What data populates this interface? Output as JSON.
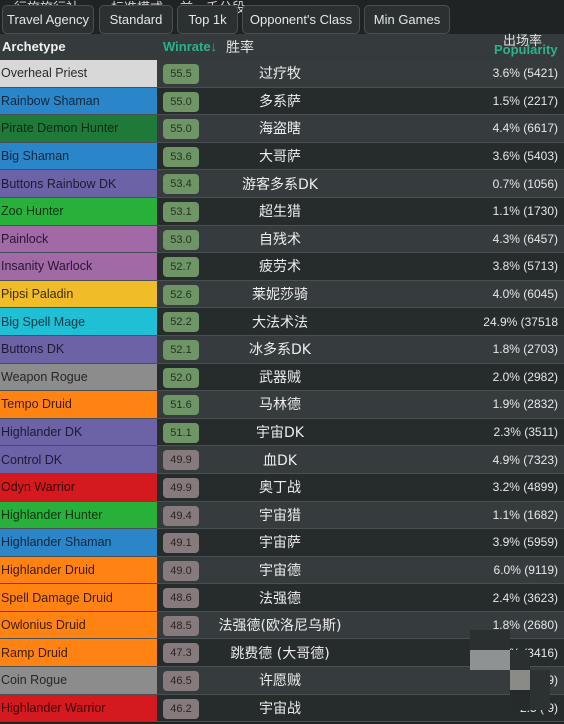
{
  "filters": [
    {
      "label": "Travel Agency",
      "zh": "行旅旅行社"
    },
    {
      "label": "Standard",
      "zh": "标准模式"
    },
    {
      "label": "Top 1k",
      "zh": "前一千分段"
    },
    {
      "label": "Opponent's Class",
      "zh": ""
    },
    {
      "label": "Min Games",
      "zh": ""
    }
  ],
  "header": {
    "archetype": "Archetype",
    "winrate": "Winrate↓",
    "winrate_zh": "胜率",
    "popularity": "Popularity",
    "popularity_zh": "出场率",
    "accent_color": "#2bb38e"
  },
  "badge_colors": {
    "positive": "#6f9466",
    "negative": "#877a7c"
  },
  "rows": [
    {
      "archetype": "Overheal Priest",
      "color": "#d8d8d8",
      "text_color": "#2a2a2a",
      "winrate": "55.5",
      "zh": "过疗牧",
      "popularity": "3.6% (5421)"
    },
    {
      "archetype": "Rainbow Shaman",
      "color": "#2b86c9",
      "text_color": "#10283d",
      "winrate": "55.0",
      "zh": "多系萨",
      "popularity": "1.5% (2217)"
    },
    {
      "archetype": "Pirate Demon Hunter",
      "color": "#1f7a3a",
      "text_color": "#0d2914",
      "winrate": "55.0",
      "zh": "海盗瞎",
      "popularity": "4.4% (6617)"
    },
    {
      "archetype": "Big Shaman",
      "color": "#2b86c9",
      "text_color": "#10283d",
      "winrate": "53.6",
      "zh": "大哥萨",
      "popularity": "3.6% (5403)"
    },
    {
      "archetype": "Buttons Rainbow DK",
      "color": "#6c63a6",
      "text_color": "#1c1a33",
      "winrate": "53.4",
      "zh": "游客多系DK",
      "popularity": "0.7% (1056)"
    },
    {
      "archetype": "Zoo Hunter",
      "color": "#28b13a",
      "text_color": "#0c3312",
      "winrate": "53.1",
      "zh": "超生猎",
      "popularity": "1.1% (1730)"
    },
    {
      "archetype": "Painlock",
      "color": "#a169a6",
      "text_color": "#2a1630",
      "winrate": "53.0",
      "zh": "自残术",
      "popularity": "4.3% (6457)"
    },
    {
      "archetype": "Insanity Warlock",
      "color": "#a169a6",
      "text_color": "#2a1630",
      "winrate": "52.7",
      "zh": "疲劳术",
      "popularity": "3.8% (5713)"
    },
    {
      "archetype": "Pipsi Paladin",
      "color": "#f0bd29",
      "text_color": "#3a2c05",
      "winrate": "52.6",
      "zh": "莱妮莎骑",
      "popularity": "4.0% (6045)"
    },
    {
      "archetype": "Big Spell Mage",
      "color": "#1fbfd6",
      "text_color": "#073a42",
      "winrate": "52.2",
      "zh": "大法术法",
      "popularity": "24.9% (37518"
    },
    {
      "archetype": "Buttons DK",
      "color": "#6c63a6",
      "text_color": "#1c1a33",
      "winrate": "52.1",
      "zh": "冰多系DK",
      "popularity": "1.8% (2703)"
    },
    {
      "archetype": "Weapon Rogue",
      "color": "#8c8c8c",
      "text_color": "#262626",
      "winrate": "52.0",
      "zh": "武器贼",
      "popularity": "2.0% (2982)"
    },
    {
      "archetype": "Tempo Druid",
      "color": "#ff8312",
      "text_color": "#3d1c02",
      "winrate": "51.6",
      "zh": "马林德",
      "popularity": "1.9% (2832)"
    },
    {
      "archetype": "Highlander DK",
      "color": "#6c63a6",
      "text_color": "#1c1a33",
      "winrate": "51.1",
      "zh": "宇宙DK",
      "popularity": "2.3% (3511)"
    },
    {
      "archetype": "Control DK",
      "color": "#6c63a6",
      "text_color": "#1c1a33",
      "winrate": "49.9",
      "zh": "血DK",
      "popularity": "4.9% (7323)"
    },
    {
      "archetype": "Odyn Warrior",
      "color": "#d41a1f",
      "text_color": "#3d0507",
      "winrate": "49.9",
      "zh": "奥丁战",
      "popularity": "3.2% (4899)"
    },
    {
      "archetype": "Highlander Hunter",
      "color": "#28b13a",
      "text_color": "#0c3312",
      "winrate": "49.4",
      "zh": "宇宙猎",
      "popularity": "1.1% (1682)"
    },
    {
      "archetype": "Highlander Shaman",
      "color": "#2b86c9",
      "text_color": "#10283d",
      "winrate": "49.1",
      "zh": "宇宙萨",
      "popularity": "3.9% (5959)"
    },
    {
      "archetype": "Highlander Druid",
      "color": "#ff8312",
      "text_color": "#3d1c02",
      "winrate": "49.0",
      "zh": "宇宙德",
      "popularity": "6.0% (9119)"
    },
    {
      "archetype": "Spell Damage Druid",
      "color": "#ff8312",
      "text_color": "#3d1c02",
      "winrate": "48.6",
      "zh": "法强德",
      "popularity": "2.4% (3623)"
    },
    {
      "archetype": "Owlonius Druid",
      "color": "#ff8312",
      "text_color": "#3d1c02",
      "winrate": "48.5",
      "zh": "法强德(欧洛尼乌斯)",
      "popularity": "1.8% (2680)"
    },
    {
      "archetype": "Ramp Druid",
      "color": "#ff8312",
      "text_color": "#3d1c02",
      "winrate": "47.3",
      "zh": "跳费德 (大哥德)",
      "popularity": "% (3416)"
    },
    {
      "archetype": "Coin Rogue",
      "color": "#8c8c8c",
      "text_color": "#262626",
      "winrate": "46.5",
      "zh": "许愿贼",
      "popularity": "9)"
    },
    {
      "archetype": "Highlander Warrior",
      "color": "#d41a1f",
      "text_color": "#3d0507",
      "winrate": "46.2",
      "zh": "宇宙战",
      "popularity": "2.5 ( 9)"
    }
  ]
}
